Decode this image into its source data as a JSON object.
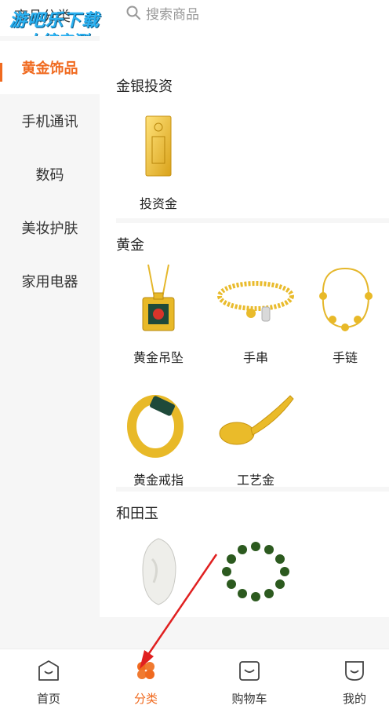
{
  "header": {
    "title": "商品分类",
    "search_placeholder": "搜索商品"
  },
  "watermark": {
    "line1": "游吧乐下载",
    "line2": "小编亲测"
  },
  "sidebar": {
    "items": [
      {
        "label": "黄金饰品",
        "active": true
      },
      {
        "label": "手机通讯",
        "active": false
      },
      {
        "label": "数码",
        "active": false
      },
      {
        "label": "美妆护肤",
        "active": false
      },
      {
        "label": "家用电器",
        "active": false
      }
    ]
  },
  "sections": [
    {
      "title": "金银投资",
      "products": [
        {
          "label": "投资金",
          "icon": "gold-bar-icon"
        }
      ]
    },
    {
      "title": "黄金",
      "products": [
        {
          "label": "黄金吊坠",
          "icon": "gold-pendant-icon"
        },
        {
          "label": "手串",
          "icon": "gold-bead-bracelet-icon"
        },
        {
          "label": "手链",
          "icon": "gold-chain-bracelet-icon"
        },
        {
          "label": "黄金戒指",
          "icon": "gold-ring-icon"
        },
        {
          "label": "工艺金",
          "icon": "gold-spoon-icon"
        }
      ]
    },
    {
      "title": "和田玉",
      "products": [
        {
          "label": "",
          "icon": "jade-pendant-icon"
        },
        {
          "label": "",
          "icon": "jade-bead-bracelet-icon"
        }
      ]
    }
  ],
  "tabbar": {
    "items": [
      {
        "label": "首页",
        "icon": "home-icon",
        "active": false
      },
      {
        "label": "分类",
        "icon": "category-icon",
        "active": true
      },
      {
        "label": "购物车",
        "icon": "cart-icon",
        "active": false
      },
      {
        "label": "我的",
        "icon": "profile-icon",
        "active": false
      }
    ]
  },
  "colors": {
    "accent": "#f06a1f",
    "sidebar_bg": "#f6f6f6",
    "text": "#222222",
    "muted": "#999999",
    "annotation": "#e02020"
  }
}
